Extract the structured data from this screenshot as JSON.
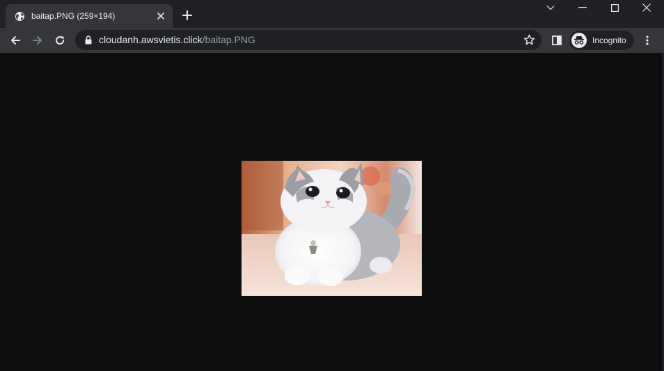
{
  "tab": {
    "title": "baitap.PNG (259×194)",
    "favicon": "globe-icon",
    "close_icon": "close-icon"
  },
  "new_tab_icon": "plus-icon",
  "window_controls": [
    "chevron-down-icon",
    "minimize-icon",
    "maximize-icon",
    "close-icon"
  ],
  "toolbar": {
    "back_icon": "back-arrow-icon",
    "forward_icon": "forward-arrow-icon",
    "reload_icon": "reload-icon",
    "url_host": "cloudanh.awsvietis.click",
    "url_path": "/baitap.PNG",
    "bookmark_icon": "star-icon",
    "side_panel_icon": "side-panel-icon",
    "profile_label": "Incognito",
    "menu_icon": "kebab-menu-icon"
  },
  "image": {
    "description_icon": "kitten-image"
  },
  "colors": {
    "tabstrip": "#202124",
    "toolbar": "#35363a",
    "page_bg": "#0e0e0e",
    "text": "#e8eaed",
    "muted_text": "#9aa0a6"
  }
}
